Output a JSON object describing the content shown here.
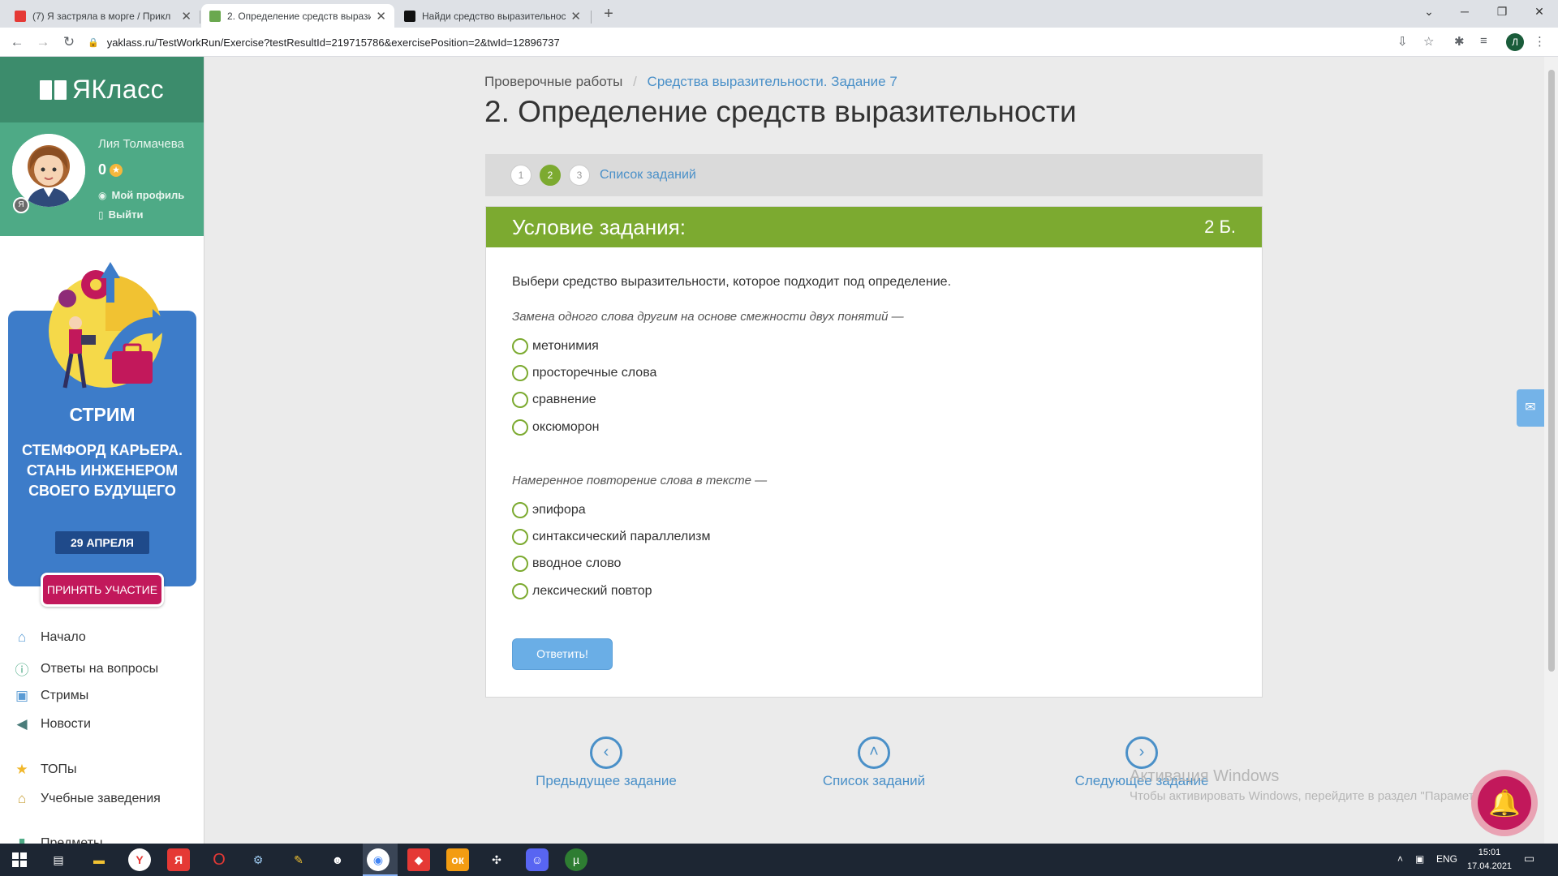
{
  "browser": {
    "tabs": [
      {
        "title": "(7) Я застряла в морге / Прикл",
        "favicon_color": "#e53935"
      },
      {
        "title": "2. Определение средств вырази",
        "favicon_color": "#6aa84f"
      },
      {
        "title": "Найди средство выразительнос",
        "favicon_color": "#111111"
      }
    ],
    "url": "yaklass.ru/TestWorkRun/Exercise?testResultId=219715786&exercisePosition=2&twId=12896737",
    "profile_initial": "Л"
  },
  "sidebar": {
    "logo": "ЯКласс",
    "user_name": "Лия Толмачева",
    "score": "0",
    "profile_link": "Мой профиль",
    "logout_link": "Выйти",
    "promo": {
      "title": "СТРИМ",
      "subtitle": "СТЕМФОРД КАРЬЕРА. СТАНЬ ИНЖЕНЕРОМ СВОЕГО БУДУЩЕГО",
      "date": "29 АПРЕЛЯ",
      "button": "ПРИНЯТЬ УЧАСТИЕ"
    },
    "menu": [
      {
        "label": "Начало",
        "icon": "home-icon"
      },
      {
        "label": "Ответы на вопросы",
        "icon": "question-icon"
      },
      {
        "label": "Стримы",
        "icon": "play-icon"
      },
      {
        "label": "Новости",
        "icon": "megaphone-icon"
      },
      {
        "label": "ТОПы",
        "icon": "star-icon"
      },
      {
        "label": "Учебные заведения",
        "icon": "institution-icon"
      },
      {
        "label": "Предметы",
        "icon": "chart-icon"
      }
    ]
  },
  "main": {
    "breadcrumb": {
      "root": "Проверочные работы",
      "current": "Средства выразительности. Задание 7"
    },
    "title": "2. Определение средств выразительности",
    "steps": [
      "1",
      "2",
      "3"
    ],
    "current_step": "2",
    "task_list_link": "Список заданий",
    "task_header": "Условие задания:",
    "points": "2 Б.",
    "instruction": "Выбери средство выразительности, которое подходит под определение.",
    "questions": [
      {
        "definition": "Замена одного слова другим на основе смежности двух понятий —",
        "options": [
          "метонимия",
          "просторечные слова",
          "сравнение",
          "оксюморон"
        ]
      },
      {
        "definition": "Намеренное повторение слова в тексте —",
        "options": [
          "эпифора",
          "синтаксический параллелизм",
          "вводное слово",
          "лексический повтор"
        ]
      }
    ],
    "answer_button": "Ответить!",
    "bottom_nav": {
      "prev": "Предыдущее задание",
      "list": "Список заданий",
      "next": "Следующее задание"
    }
  },
  "windows_watermark": {
    "title": "Активация Windows",
    "text": "Чтобы активировать Windows, перейдите в раздел \"Параметры\"."
  },
  "taskbar": {
    "lang": "ENG",
    "time": "15:01",
    "date": "17.04.2021"
  }
}
